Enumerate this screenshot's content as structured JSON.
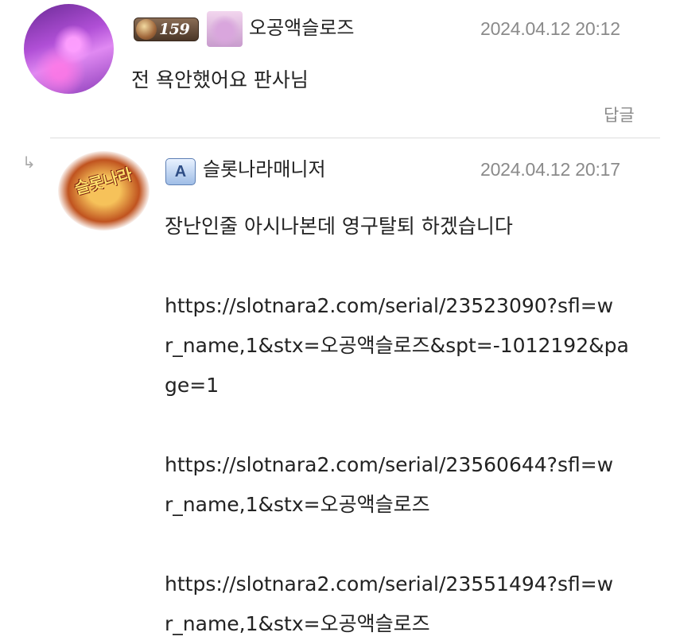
{
  "comment": {
    "author": {
      "level": "159",
      "nickname": "오공액슬로즈"
    },
    "timestamp": "2024.04.12 20:12",
    "text": "전 욕안했어요 판사님",
    "reply_label": "답글"
  },
  "reply": {
    "author": {
      "badge": "A",
      "nickname": "슬롯나라매니저",
      "avatar_logo_text": "슬롯나라"
    },
    "timestamp": "2024.04.12 20:17",
    "lines": [
      "장난인줄 아시나본데 영구탈퇴 하겠습니다",
      "https://slotnara2.com/serial/23523090?sfl=w",
      "r_name,1&stx=오공액슬로즈&spt=-1012192&pa",
      "ge=1",
      "https://slotnara2.com/serial/23560644?sfl=w",
      "r_name,1&stx=오공액슬로즈",
      "https://slotnara2.com/serial/23551494?sfl=w",
      "r_name,1&stx=오공액슬로즈"
    ]
  },
  "icons": {
    "reply_arrow": "reply-arrow-icon",
    "level_badge": "level-badge-icon",
    "profile_badge": "profile-badge-icon",
    "admin_badge": "admin-badge-icon"
  },
  "colors": {
    "text": "#222222",
    "meta": "#8a8a8a",
    "divider": "#dddddd"
  }
}
